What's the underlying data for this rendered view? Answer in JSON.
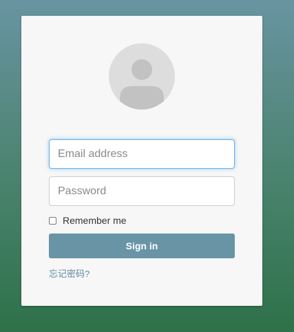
{
  "login": {
    "avatar_icon": "user-avatar-icon",
    "email": {
      "value": "",
      "placeholder": "Email address"
    },
    "password": {
      "value": "",
      "placeholder": "Password"
    },
    "remember_label": "Remember me",
    "remember_checked": false,
    "signin_label": "Sign in",
    "forgot_label": "忘记密码?"
  },
  "colors": {
    "background_top": "#6994a2",
    "background_bottom": "#2e7149",
    "card": "#f7f7f7",
    "button": "#6994a6",
    "link": "#5e8aa3",
    "focus_ring": "#66afe9"
  }
}
